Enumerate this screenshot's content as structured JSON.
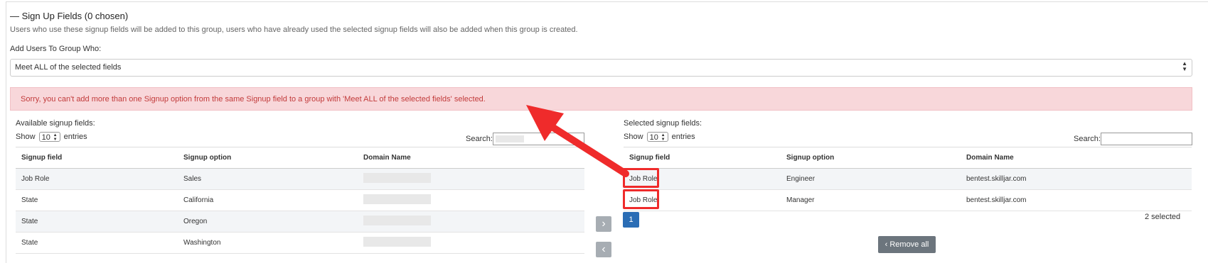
{
  "section": {
    "title": "— Sign Up Fields (0 chosen)",
    "description": "Users who use these signup fields will be added to this group, users who have already used the selected signup fields will also be added when this group is created."
  },
  "add_users": {
    "label": "Add Users To Group Who:",
    "selected": "Meet ALL of the selected fields"
  },
  "alert": {
    "message": "Sorry, you can't add more than one Signup option from the same Signup field to a group with 'Meet ALL of the selected fields' selected."
  },
  "available": {
    "label": "Available signup fields:",
    "show_prefix": "Show",
    "entries_value": "10",
    "entries_suffix": "entries",
    "search_label": "Search:",
    "columns": [
      "Signup field",
      "Signup option",
      "Domain Name"
    ],
    "rows": [
      {
        "field": "Job Role",
        "option": "Sales",
        "domain": ""
      },
      {
        "field": "State",
        "option": "California",
        "domain": ""
      },
      {
        "field": "State",
        "option": "Oregon",
        "domain": ""
      },
      {
        "field": "State",
        "option": "Washington",
        "domain": ""
      }
    ]
  },
  "selected": {
    "label": "Selected signup fields:",
    "show_prefix": "Show",
    "entries_value": "10",
    "entries_suffix": "entries",
    "search_label": "Search:",
    "columns": [
      "Signup field",
      "Signup option",
      "Domain Name"
    ],
    "rows": [
      {
        "field": "Job Role",
        "option": "Engineer",
        "domain": "bentest.skilljar.com"
      },
      {
        "field": "Job Role",
        "option": "Manager",
        "domain": "bentest.skilljar.com"
      }
    ],
    "page": "1",
    "count_text": "2 selected",
    "remove_all": "Remove all"
  },
  "icons": {
    "move_right": "chevron-right-icon",
    "move_left": "chevron-left-icon",
    "remove_all": "chevron-left-icon"
  },
  "colors": {
    "alert_bg": "#f8d7da",
    "alert_text": "#c23b3b",
    "annotation": "#ef2b2b",
    "page_button": "#2a6db5",
    "remove_button": "#6c757d"
  }
}
